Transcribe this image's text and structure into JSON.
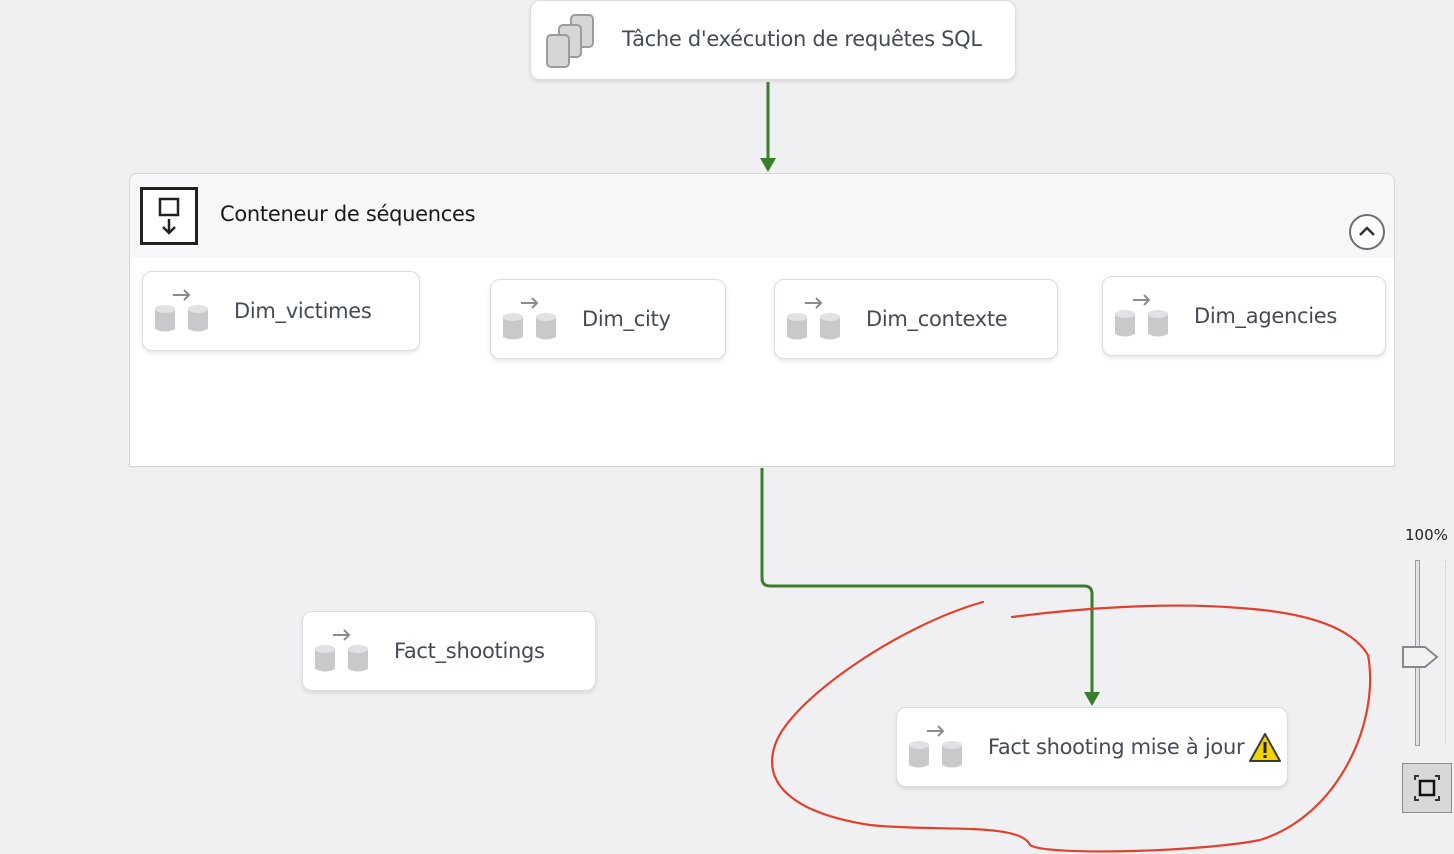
{
  "tasks": {
    "sql": {
      "label": "Tâche d'exécution de requêtes SQL",
      "icon": "sql-task-icon"
    },
    "dim_victimes": {
      "label": "Dim_victimes",
      "icon": "data-flow-icon"
    },
    "dim_city": {
      "label": "Dim_city",
      "icon": "data-flow-icon"
    },
    "dim_contexte": {
      "label": "Dim_contexte",
      "icon": "data-flow-icon"
    },
    "dim_agencies": {
      "label": "Dim_agencies",
      "icon": "data-flow-icon"
    },
    "fact_shootings": {
      "label": "Fact_shootings",
      "icon": "data-flow-icon"
    },
    "fact_update": {
      "label": "Fact shooting mise à jour",
      "icon": "data-flow-icon",
      "status_icon": "warning-icon"
    }
  },
  "container": {
    "title": "Conteneur de séquences",
    "icon": "sequence-container-icon",
    "collapse_icon": "chevron-up-icon"
  },
  "zoom": {
    "label": "100%",
    "level_percent": 100
  },
  "colors": {
    "connector": "#3a7d2c",
    "annotation": "#e0412c",
    "warning": "#f2d300"
  }
}
